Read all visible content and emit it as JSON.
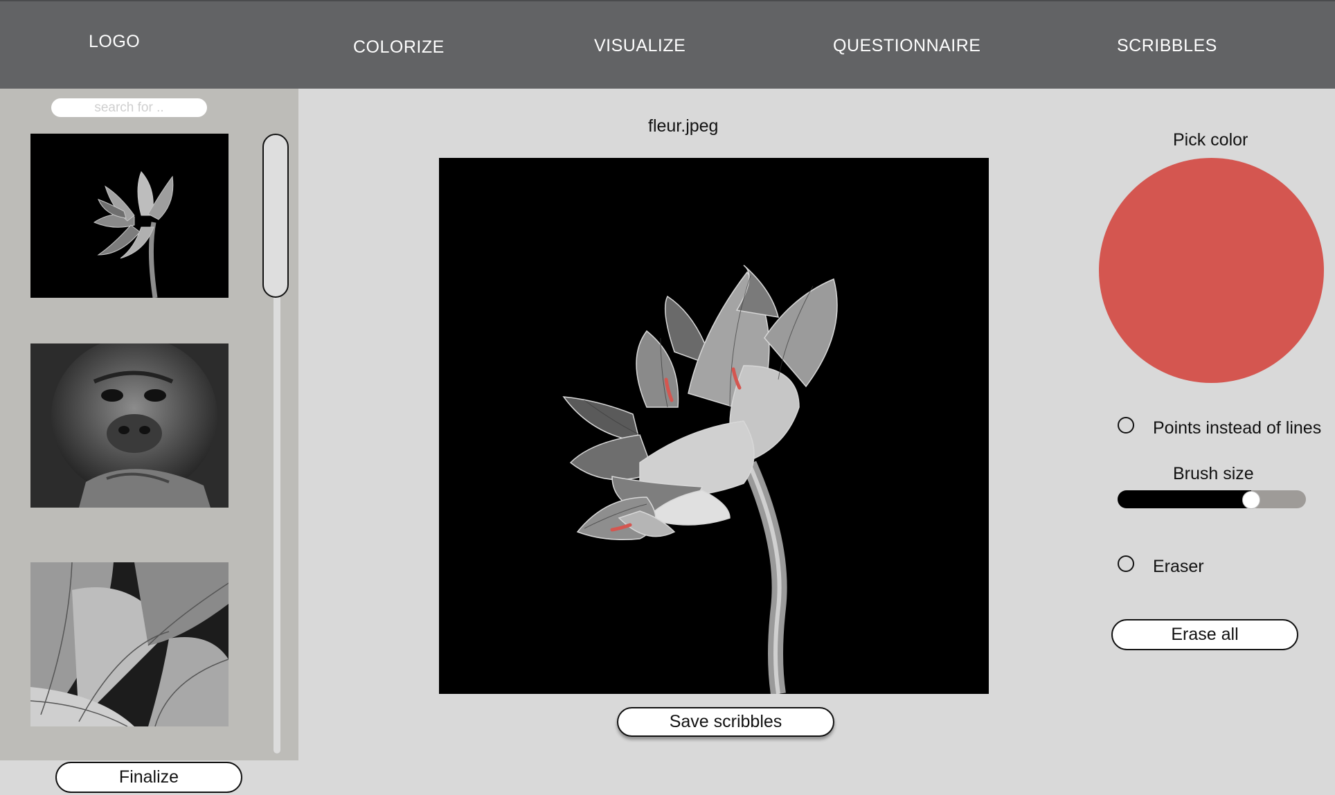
{
  "nav": {
    "logo": "LOGO",
    "links": [
      "COLORIZE",
      "VISUALIZE",
      "QUESTIONNAIRE",
      "SCRIBBLES"
    ]
  },
  "sidebar": {
    "search_placeholder": "search for ..",
    "thumbnails": [
      {
        "icon": "lotus-flower-image"
      },
      {
        "icon": "gorilla-portrait-image"
      },
      {
        "icon": "banana-leaves-image"
      }
    ],
    "finalize_label": "Finalize"
  },
  "main": {
    "filename": "fleur.jpeg",
    "save_label": "Save scribbles"
  },
  "tools": {
    "pick_color_label": "Pick color",
    "selected_color": "#d45650",
    "points_label": "Points instead of lines",
    "brush_size_label": "Brush size",
    "brush_size_value": 0.71,
    "eraser_label": "Eraser",
    "erase_all_label": "Erase all"
  },
  "colors": {
    "topbar": "#626365",
    "sidebar": "#bdbcb8",
    "background": "#d9d9d9",
    "scribble": "#d45650"
  }
}
